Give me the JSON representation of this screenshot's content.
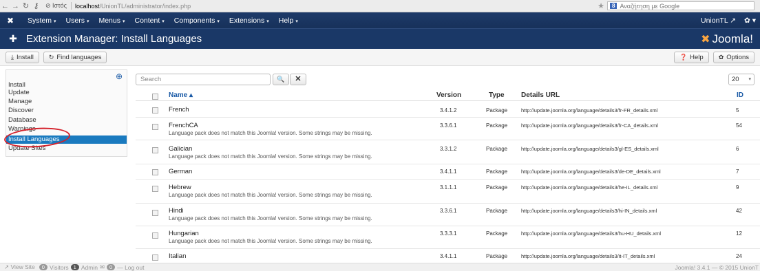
{
  "browser": {
    "back_icon": "←",
    "forward_icon": "→",
    "reload_icon": "↻",
    "key_icon": "⚷",
    "site_label": "⊘ Ιστός",
    "url_host": "localhost",
    "url_path": "/UnionTL/administrator/index.php",
    "star_icon": "★",
    "search_engine_badge": "8",
    "search_placeholder": "Αναζήτηση με Google"
  },
  "topbar": {
    "logo": "✖",
    "menus": [
      "System",
      "Users",
      "Menus",
      "Content",
      "Components",
      "Extensions",
      "Help"
    ],
    "caret": "▾",
    "user_label": "UnionTL ↗",
    "gear": "✿ ▾"
  },
  "header": {
    "icon": "✚",
    "title": "Extension Manager: Install Languages",
    "brand_x": "✖",
    "brand_text": "Joomla!"
  },
  "toolbar": {
    "install_icon": "⤓",
    "install_label": "Install",
    "find_icon": "↻",
    "find_label": "Find languages",
    "help_icon": "❓",
    "help_label": "Help",
    "options_icon": "✿",
    "options_label": "Options"
  },
  "sidebar": {
    "collapse_icon": "⊕",
    "items": [
      {
        "label": "Install",
        "active": false
      },
      {
        "label": "Update",
        "active": false
      },
      {
        "label": "Manage",
        "active": false
      },
      {
        "label": "Discover",
        "active": false
      },
      {
        "label": "Database",
        "active": false
      },
      {
        "label": "Warnings",
        "active": false
      },
      {
        "label": "Install Languages",
        "active": true
      },
      {
        "label": "Update Sites",
        "active": false
      }
    ]
  },
  "filter": {
    "search_placeholder": "Search",
    "search_icon": "🔍",
    "clear_icon": "✕",
    "limit": "20",
    "limit_caret": "▾"
  },
  "table": {
    "headers": {
      "name": "Name ▴",
      "version": "Version",
      "type": "Type",
      "url": "Details URL",
      "id": "ID"
    },
    "rows": [
      {
        "name": "French",
        "warning": "",
        "version": "3.4.1.2",
        "type": "Package",
        "url": "http://update.joomla.org/language/details3/fr-FR_details.xml",
        "id": "5"
      },
      {
        "name": "FrenchCA",
        "warning": "Language pack does not match this Joomla! version. Some strings may be missing.",
        "version": "3.3.6.1",
        "type": "Package",
        "url": "http://update.joomla.org/language/details3/fr-CA_details.xml",
        "id": "54"
      },
      {
        "name": "Galician",
        "warning": "Language pack does not match this Joomla! version. Some strings may be missing.",
        "version": "3.3.1.2",
        "type": "Package",
        "url": "http://update.joomla.org/language/details3/gl-ES_details.xml",
        "id": "6"
      },
      {
        "name": "German",
        "warning": "",
        "version": "3.4.1.1",
        "type": "Package",
        "url": "http://update.joomla.org/language/details3/de-DE_details.xml",
        "id": "7"
      },
      {
        "name": "Hebrew",
        "warning": "Language pack does not match this Joomla! version. Some strings may be missing.",
        "version": "3.1.1.1",
        "type": "Package",
        "url": "http://update.joomla.org/language/details3/he-IL_details.xml",
        "id": "9"
      },
      {
        "name": "Hindi",
        "warning": "Language pack does not match this Joomla! version. Some strings may be missing.",
        "version": "3.3.6.1",
        "type": "Package",
        "url": "http://update.joomla.org/language/details3/hi-IN_details.xml",
        "id": "42"
      },
      {
        "name": "Hungarian",
        "warning": "Language pack does not match this Joomla! version. Some strings may be missing.",
        "version": "3.3.3.1",
        "type": "Package",
        "url": "http://update.joomla.org/language/details3/hu-HU_details.xml",
        "id": "12"
      },
      {
        "name": "Italian",
        "warning": "",
        "version": "3.4.1.1",
        "type": "Package",
        "url": "http://update.joomla.org/language/details3/it-IT_details.xml",
        "id": "24"
      }
    ]
  },
  "footer": {
    "view_site": "↗ View Site",
    "visitors_count": "0",
    "visitors_label": "Visitors",
    "admin_count": "1",
    "admin_label": "Admin",
    "mail_icon": "✉",
    "mail_count": "0",
    "logout": "— Log out",
    "copyright": "Joomla! 3.4.1 — © 2015 UnionT"
  },
  "colors": {
    "topbar": "#17315a",
    "active": "#1a7abf",
    "highlight": "#d4202a"
  }
}
